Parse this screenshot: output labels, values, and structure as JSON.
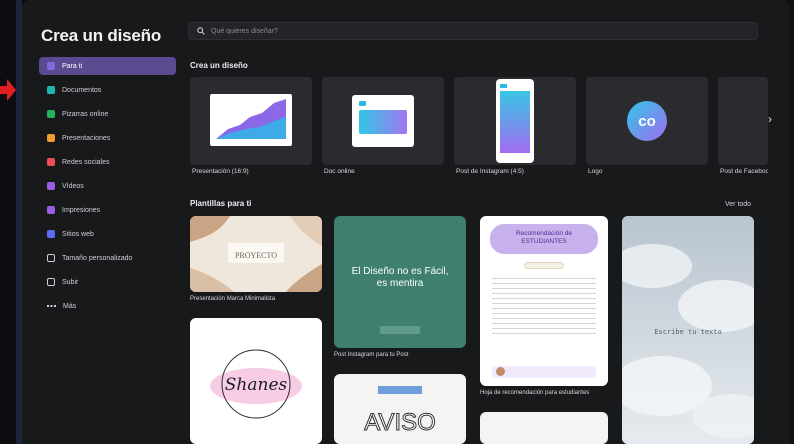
{
  "modal_title": "Crea un diseño",
  "search": {
    "placeholder": "Qué quieres diseñar?"
  },
  "sidebar": {
    "items": [
      {
        "label": "Para ti",
        "icon": "sparkle-icon",
        "color": "#7c6cd8",
        "active": true
      },
      {
        "label": "Documentos",
        "icon": "document-icon",
        "color": "#1fb6b0"
      },
      {
        "label": "Pizarras online",
        "icon": "whiteboard-icon",
        "color": "#21b35a"
      },
      {
        "label": "Presentaciones",
        "icon": "presentation-icon",
        "color": "#f29c2e"
      },
      {
        "label": "Redes sociales",
        "icon": "heart-icon",
        "color": "#ee4b59"
      },
      {
        "label": "Vídeos",
        "icon": "video-icon",
        "color": "#9b5de5"
      },
      {
        "label": "Impresiones",
        "icon": "print-icon",
        "color": "#9b5de5"
      },
      {
        "label": "Sitios web",
        "icon": "website-icon",
        "color": "#5b6cf0"
      },
      {
        "label": "Tamaño personalizado",
        "icon": "custom-size-icon",
        "color": "#cfcfd6"
      },
      {
        "label": "Subir",
        "icon": "upload-icon",
        "color": "#cfcfd6"
      },
      {
        "label": "Más",
        "icon": "more-icon",
        "color": "#cfcfd6"
      }
    ]
  },
  "create_section": {
    "title": "Crea un diseño",
    "cards": [
      {
        "label": "Presentación (16:9)",
        "icon": "presentation-thumb-icon"
      },
      {
        "label": "Doc online",
        "icon": "doc-thumb-icon"
      },
      {
        "label": "Post de Instagram (4:5)",
        "icon": "instagram-post-thumb-icon"
      },
      {
        "label": "Logo",
        "icon": "logo-thumb-icon",
        "logo_text": "co"
      },
      {
        "label": "Post de Facebook",
        "icon": "facebook-post-thumb-icon"
      }
    ]
  },
  "templates_section": {
    "title": "Plantillas para ti",
    "see_all": "Ver todo",
    "templates": [
      {
        "label": "Presentación Marca Minimalista",
        "text": "PROYECTO"
      },
      {
        "label": "",
        "text": "Shanes"
      },
      {
        "label": "Post Instagram para tu Post",
        "text": "El Diseño no es Fácil, es mentira"
      },
      {
        "label": "",
        "text": "AVISO"
      },
      {
        "label": "Hoja de recomendación para estudiantes",
        "text": "Recomendación de ESTUDIANTES"
      },
      {
        "label": "",
        "text": "Escribe tu texto"
      }
    ]
  },
  "colors": {
    "accent": "#5b4a8f",
    "background": "#18191b",
    "card": "#2a2b2f",
    "arrow": "#e02020"
  }
}
